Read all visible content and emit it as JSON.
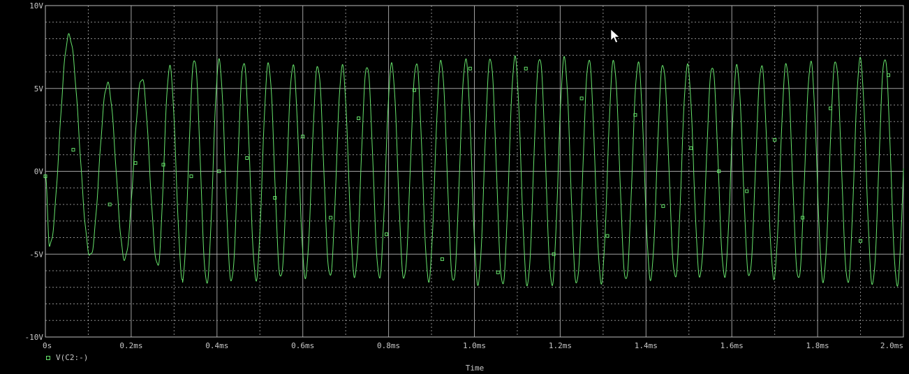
{
  "colors": {
    "background": "#000000",
    "grid": "#bdbdbd",
    "trace": "#66e36b",
    "text": "#c8c8c8"
  },
  "chart_data": {
    "type": "line",
    "xlabel": "Time",
    "ylabel": "",
    "xlim": [
      0,
      2.0
    ],
    "ylim": [
      -10,
      10
    ],
    "x_unit": "ms",
    "y_unit": "V",
    "x_ticks": [
      0,
      0.2,
      0.4,
      0.6,
      0.8,
      1.0,
      1.2,
      1.4,
      1.6,
      1.8,
      2.0
    ],
    "x_tick_labels": [
      "0s",
      "0.2ms",
      "0.4ms",
      "0.6ms",
      "0.8ms",
      "1.0ms",
      "1.2ms",
      "1.4ms",
      "1.6ms",
      "1.8ms",
      "2.0ms"
    ],
    "y_ticks": [
      -10,
      -5,
      0,
      5,
      10
    ],
    "y_tick_labels": [
      "-10V",
      "-5V",
      "0V",
      "5V",
      "10V"
    ],
    "grid": true,
    "legend": {
      "position": "bottom-left",
      "entries": [
        "V(C2:-)"
      ]
    },
    "series": [
      {
        "name": "V(C2:-)",
        "marker": "square",
        "waveform": "sine",
        "frequency_khz": 17.4,
        "amplitude_v": 6.6,
        "offset_v": 0.0,
        "startup": {
          "peaks_ms": [
            0.055,
            0.145,
            0.225,
            0.29
          ],
          "peak_values_v": [
            8.2,
            5.3,
            5.6,
            6.3
          ],
          "troughs_ms": [
            0.01,
            0.105,
            0.185,
            0.262
          ],
          "trough_values_v": [
            -4.5,
            -5.1,
            -5.3,
            -5.7
          ]
        },
        "marker_points": [
          {
            "x": 0.0,
            "y": -0.3
          },
          {
            "x": 0.065,
            "y": 1.3
          },
          {
            "x": 0.15,
            "y": -2.0
          },
          {
            "x": 0.21,
            "y": 0.5
          },
          {
            "x": 0.275,
            "y": 0.4
          },
          {
            "x": 0.34,
            "y": -0.3
          },
          {
            "x": 0.405,
            "y": 0.0
          },
          {
            "x": 0.47,
            "y": 0.8
          },
          {
            "x": 0.535,
            "y": -1.6
          },
          {
            "x": 0.6,
            "y": 2.1
          },
          {
            "x": 0.665,
            "y": -2.8
          },
          {
            "x": 0.73,
            "y": 3.2
          },
          {
            "x": 0.795,
            "y": -3.8
          },
          {
            "x": 0.86,
            "y": 4.9
          },
          {
            "x": 0.925,
            "y": -5.3
          },
          {
            "x": 0.99,
            "y": 6.2
          },
          {
            "x": 1.055,
            "y": -6.1
          },
          {
            "x": 1.12,
            "y": 6.2
          },
          {
            "x": 1.185,
            "y": -5.0
          },
          {
            "x": 1.25,
            "y": 4.4
          },
          {
            "x": 1.31,
            "y": -3.9
          },
          {
            "x": 1.375,
            "y": 3.4
          },
          {
            "x": 1.44,
            "y": -2.1
          },
          {
            "x": 1.505,
            "y": 1.4
          },
          {
            "x": 1.57,
            "y": 0.0
          },
          {
            "x": 1.635,
            "y": -1.2
          },
          {
            "x": 1.7,
            "y": 1.9
          },
          {
            "x": 1.765,
            "y": -2.8
          },
          {
            "x": 1.83,
            "y": 3.8
          },
          {
            "x": 1.9,
            "y": -4.2
          },
          {
            "x": 1.965,
            "y": 5.8
          }
        ]
      }
    ]
  }
}
